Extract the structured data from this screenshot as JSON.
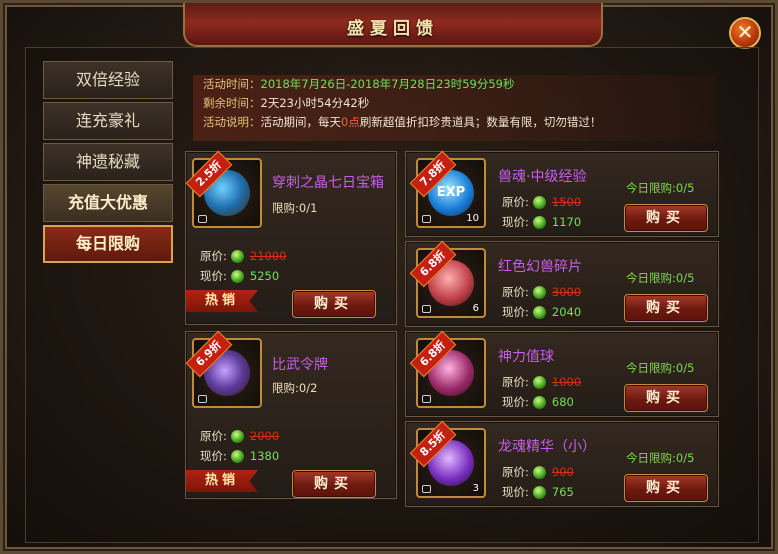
{
  "window": {
    "title": "盛夏回馈",
    "close_symbol": "✕"
  },
  "tabs": [
    {
      "label": "双倍经验"
    },
    {
      "label": "连充豪礼"
    },
    {
      "label": "神遗秘藏"
    },
    {
      "label": "充值大优惠"
    },
    {
      "label": "每日限购"
    }
  ],
  "info": {
    "time_label": "活动时间：",
    "time_value": "2018年7月26日-2018年7月28日23时59分59秒",
    "remain_label": "剩余时间：",
    "remain_value": "2天23小时54分42秒",
    "desc_label": "活动说明：",
    "desc_a": "活动期间，每天",
    "desc_highlight": "0点",
    "desc_b": "刷新超值折扣珍贵道具；数量有限，切勿错过！"
  },
  "labels": {
    "original": "原价:",
    "current": "现价:",
    "buy": "购买",
    "hot": "热销"
  },
  "big_items": [
    {
      "discount": "2.5折",
      "name": "穿刺之晶七日宝箱",
      "limit": "限购:0/1",
      "old_price": "21000",
      "new_price": "5250"
    },
    {
      "discount": "6.9折",
      "name": "比武令牌",
      "limit": "限购:0/2",
      "old_price": "2000",
      "new_price": "1380"
    }
  ],
  "small_items": [
    {
      "discount": "7.8折",
      "name": "兽魂·中级经验",
      "qty": "10",
      "limit": "今日限购:0/5",
      "old_price": "1500",
      "new_price": "1170",
      "icon_text": "EXP"
    },
    {
      "discount": "6.8折",
      "name": "红色幻兽碎片",
      "qty": "6",
      "limit": "今日限购:0/5",
      "old_price": "3000",
      "new_price": "2040"
    },
    {
      "discount": "6.8折",
      "name": "神力值球",
      "qty": "",
      "limit": "今日限购:0/5",
      "old_price": "1000",
      "new_price": "680"
    },
    {
      "discount": "8.5折",
      "name": "龙魂精华（小）",
      "qty": "3",
      "limit": "今日限购:0/5",
      "old_price": "900",
      "new_price": "765"
    }
  ]
}
